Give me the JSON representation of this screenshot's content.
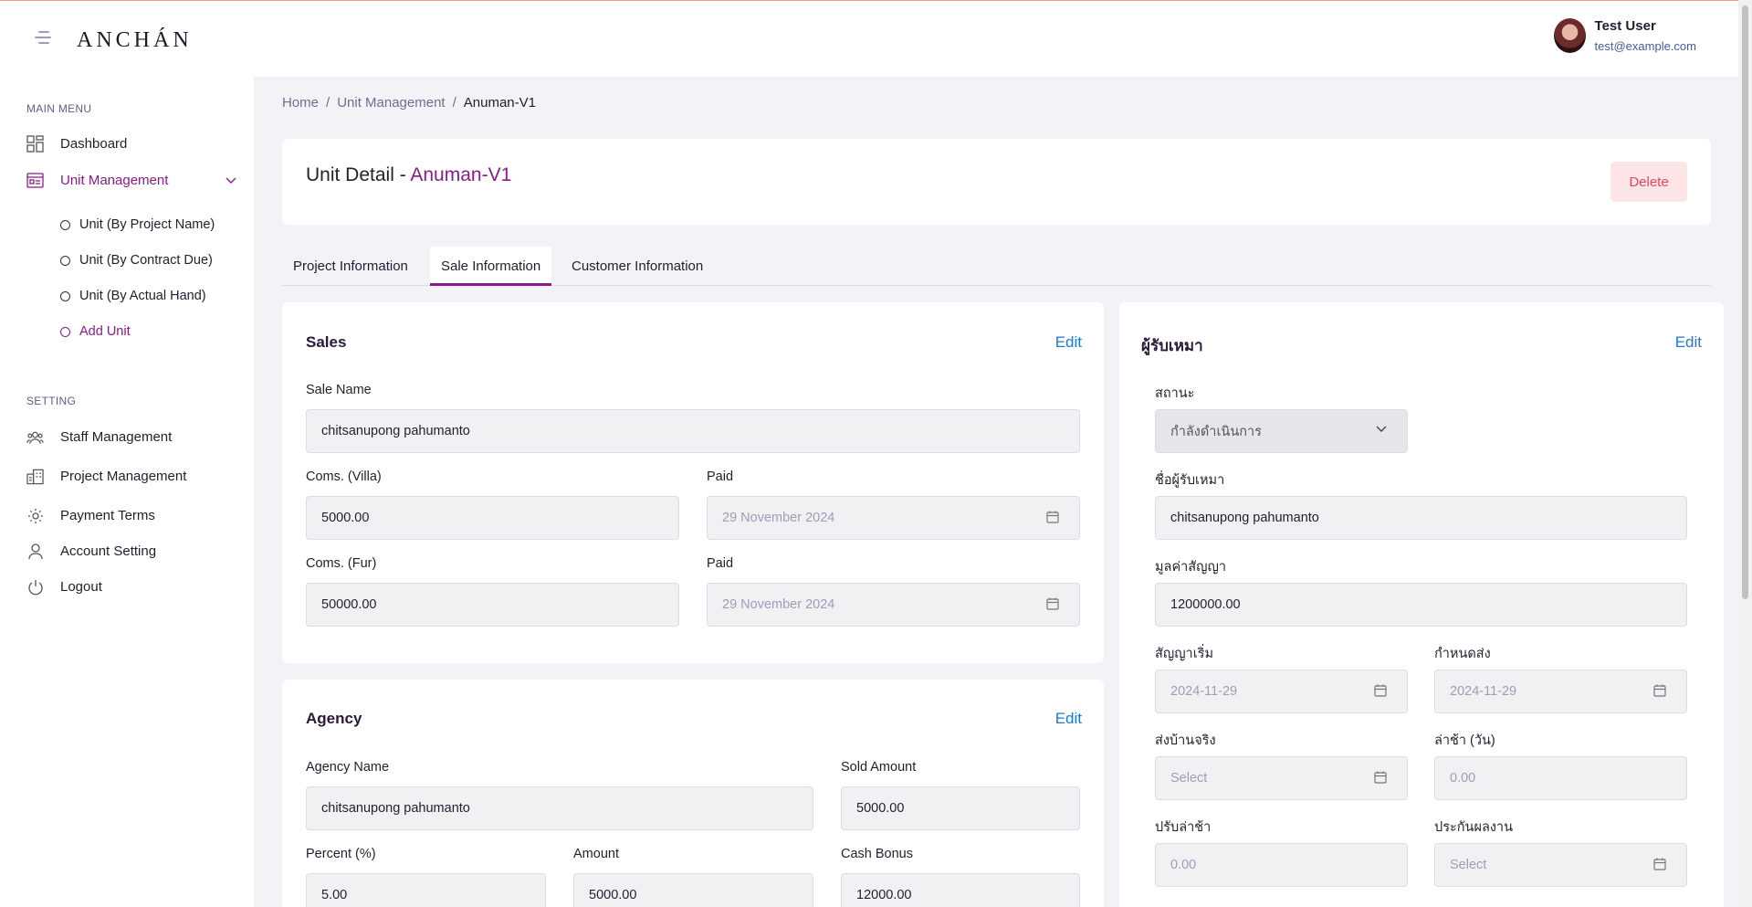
{
  "app": {
    "logo": "ANCHÁN"
  },
  "user": {
    "name": "Test User",
    "email": "test@example.com"
  },
  "sidebar": {
    "main_menu_title": "MAIN MENU",
    "dashboard": "Dashboard",
    "unit_management": "Unit Management",
    "sub_items": [
      "Unit (By Project Name)",
      "Unit (By Contract Due)",
      "Unit (By Actual Hand)",
      "Add Unit"
    ],
    "setting_title": "SETTING",
    "staff": "Staff Management",
    "project": "Project Management",
    "payment": "Payment Terms",
    "account": "Account Setting",
    "logout": "Logout"
  },
  "breadcrumb": {
    "home": "Home",
    "section": "Unit Management",
    "current": "Anuman-V1"
  },
  "header": {
    "title_prefix": "Unit Detail - ",
    "title_unit": "Anuman-V1",
    "delete_label": "Delete"
  },
  "tabs": [
    "Project Information",
    "Sale Information",
    "Customer Information"
  ],
  "sales": {
    "title": "Sales",
    "edit": "Edit",
    "sale_name_label": "Sale Name",
    "sale_name": "chitsanupong pahumanto",
    "coms_villa_label": "Coms. (Villa)",
    "coms_villa": "5000.00",
    "paid1_label": "Paid",
    "paid1": "29 November 2024",
    "coms_fur_label": "Coms. (Fur)",
    "coms_fur": "50000.00",
    "paid2_label": "Paid",
    "paid2": "29 November 2024"
  },
  "agency": {
    "title": "Agency",
    "edit": "Edit",
    "name_label": "Agency Name",
    "name": "chitsanupong pahumanto",
    "sold_label": "Sold Amount",
    "sold": "5000.00",
    "percent_label": "Percent (%)",
    "percent": "5.00",
    "amount_label": "Amount",
    "amount": "5000.00",
    "bonus_label": "Cash Bonus",
    "bonus": "12000.00"
  },
  "contractor": {
    "title": "ผู้รับเหมา",
    "edit": "Edit",
    "status_label": "สถานะ",
    "status": "กำลังดำเนินการ",
    "name_label": "ชื่อผู้รับเหมา",
    "name": "chitsanupong pahumanto",
    "value_label": "มูลค่าสัญญา",
    "value": "1200000.00",
    "start_label": "สัญญาเริ่ม",
    "start": "2024-11-29",
    "due_label": "กำหนดส่ง",
    "due": "2024-11-29",
    "actual_label": "ส่งบ้านจริง",
    "actual": "Select",
    "delay_label": "ล่าช้า (วัน)",
    "delay": "0.00",
    "fine_label": "ปรับล่าช้า",
    "fine": "0.00",
    "warranty_label": "ประกันผลงาน",
    "warranty": "Select"
  }
}
